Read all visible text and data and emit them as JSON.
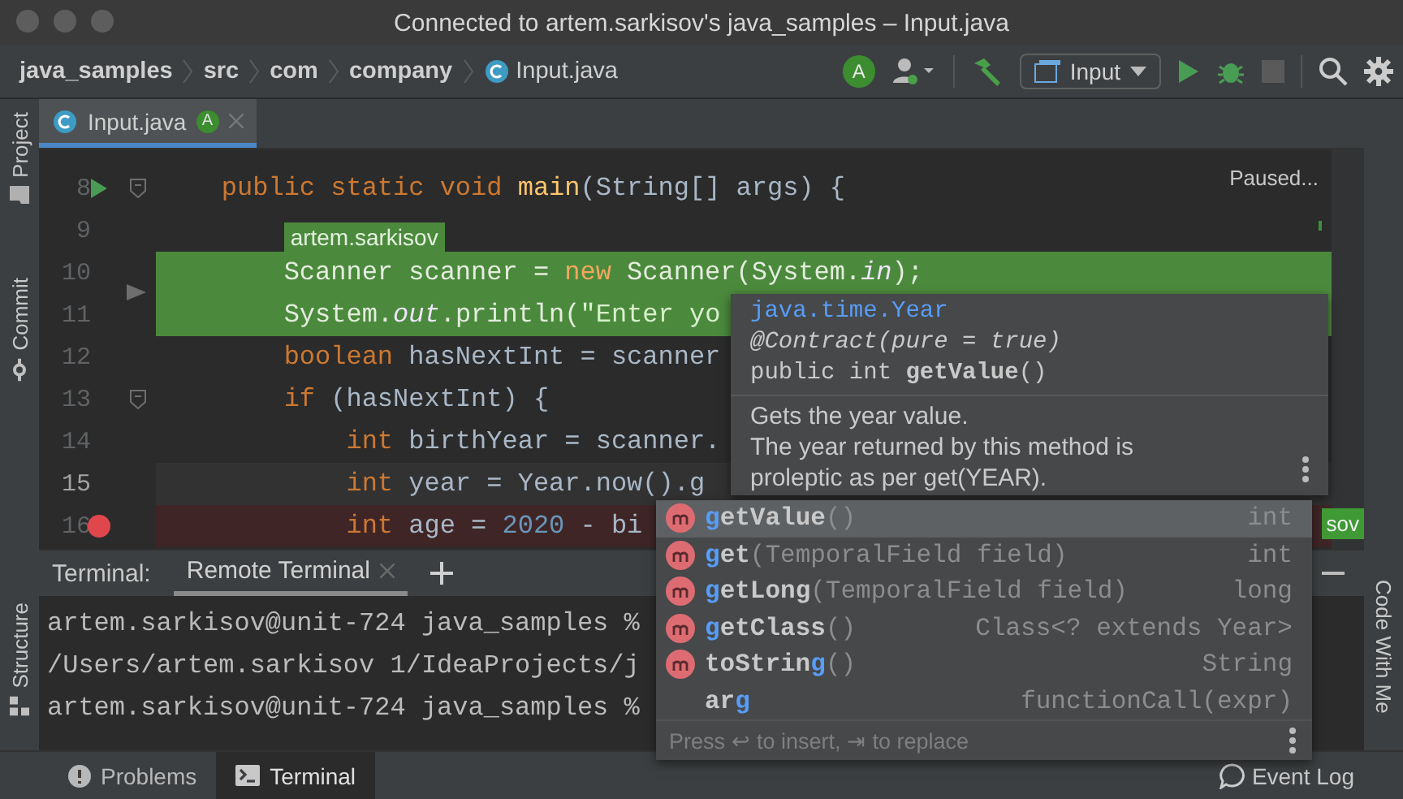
{
  "window": {
    "title": "Connected to artem.sarkisov's java_samples – Input.java"
  },
  "breadcrumbs": [
    {
      "label": "java_samples",
      "kind": "folder"
    },
    {
      "label": "src",
      "kind": "folder"
    },
    {
      "label": "com",
      "kind": "folder"
    },
    {
      "label": "company",
      "kind": "folder"
    },
    {
      "label": "Input.java",
      "kind": "file"
    }
  ],
  "toolbar": {
    "avatar": "A",
    "run_config": "Input",
    "stop_disabled": true
  },
  "left_tools": [
    {
      "label": "Project",
      "kind": "project"
    },
    {
      "label": "Commit",
      "kind": "commit"
    },
    {
      "label": "Structure",
      "kind": "structure"
    }
  ],
  "right_tools": [
    {
      "label": "Code With Me"
    }
  ],
  "editor_tabs": [
    {
      "label": "Input.java",
      "badge": "A",
      "selected": true
    }
  ],
  "editor": {
    "status": "Paused...",
    "lines": [
      {
        "number": "8",
        "run_marker": true,
        "fold": true,
        "tokens": [
          {
            "text": "public static void ",
            "kind": "keyword"
          },
          {
            "text": "main",
            "kind": "method"
          },
          {
            "text": "(String[] args) {",
            "kind": "plain"
          }
        ],
        "children": [
          {
            "number": "9",
            "author": "artem.sarkisov"
          },
          {
            "number": "10",
            "added": true,
            "tokens": [
              {
                "text": "Scanner scanner = ",
                "kind": "plain"
              },
              {
                "text": "new ",
                "kind": "keyword"
              },
              {
                "text": "Scanner(System.",
                "kind": "plain"
              },
              {
                "text": "in",
                "kind": "field"
              },
              {
                "text": ");",
                "kind": "plain"
              }
            ]
          },
          {
            "number": "11",
            "execution_pointer": true,
            "added": true,
            "tokens": [
              {
                "text": "System.",
                "kind": "plain"
              },
              {
                "text": "out",
                "kind": "field"
              },
              {
                "text": ".println(",
                "kind": "plain"
              },
              {
                "text": "\"Enter yo",
                "kind": "string"
              }
            ]
          },
          {
            "number": "12",
            "tokens": [
              {
                "text": "boolean ",
                "kind": "keyword"
              },
              {
                "text": "hasNextInt = scanner",
                "kind": "plain"
              }
            ]
          },
          {
            "number": "13",
            "fold": true,
            "tokens": [
              {
                "text": "if ",
                "kind": "keyword"
              },
              {
                "text": "(hasNextInt) {",
                "kind": "plain"
              }
            ],
            "children": [
              {
                "number": "14",
                "tokens": [
                  {
                    "text": "int ",
                    "kind": "keyword"
                  },
                  {
                    "text": "birthYear = scanner.",
                    "kind": "plain"
                  }
                ]
              },
              {
                "number": "15",
                "current": true,
                "tokens": [
                  {
                    "text": "int ",
                    "kind": "keyword"
                  },
                  {
                    "text": "year = Year.now().g",
                    "kind": "plain"
                  }
                ]
              },
              {
                "number": "16",
                "breakpoint": true,
                "author_tag": "sov",
                "tokens": [
                  {
                    "text": "int ",
                    "kind": "keyword"
                  },
                  {
                    "text": "age = ",
                    "kind": "plain"
                  },
                  {
                    "text": "2020",
                    "kind": "number"
                  },
                  {
                    "text": " - bi",
                    "kind": "plain"
                  }
                ]
              }
            ]
          }
        ]
      }
    ]
  },
  "terminal": {
    "label": "Terminal:",
    "tabs": [
      {
        "label": "Remote Terminal",
        "selected": true
      }
    ],
    "lines": [
      "artem.sarkisov@unit-724 java_samples %",
      "/Users/artem.sarkisov 1/IdeaProjects/j",
      "artem.sarkisov@unit-724 java_samples %"
    ]
  },
  "bottom_tabs": [
    {
      "label": "Problems",
      "kind": "problems",
      "selected": false
    },
    {
      "label": "Terminal",
      "kind": "terminal",
      "selected": true
    }
  ],
  "event_log": "Event Log",
  "doc_popup": {
    "class": "java.time.Year",
    "annotation": "@Contract(pure = true)",
    "signature": "public int **getValue**()",
    "description": [
      "Gets the year value.",
      "The year returned by this method is",
      "proleptic as per get(YEAR)."
    ]
  },
  "completion": {
    "items": [
      {
        "match": "g",
        "after": "etValue",
        "params": "()",
        "type": "int",
        "selected": true
      },
      {
        "match": "g",
        "after": "et",
        "params": "(TemporalField field)",
        "type": "int",
        "selected": false
      },
      {
        "match": "g",
        "after": "etLong",
        "params": "(TemporalField field)",
        "type": "long",
        "selected": false
      },
      {
        "match": "g",
        "after": "etClass",
        "params": "()",
        "type": "Class<? extends Year>",
        "selected": false
      },
      {
        "before": "toStrin",
        "match": "g",
        "params": "()",
        "type": "String",
        "selected": false
      },
      {
        "before": "ar",
        "match": "g",
        "type": "functionCall(expr)",
        "kind": "template",
        "selected": false
      }
    ],
    "hint": "Press ↩ to insert, ⇥ to replace"
  }
}
